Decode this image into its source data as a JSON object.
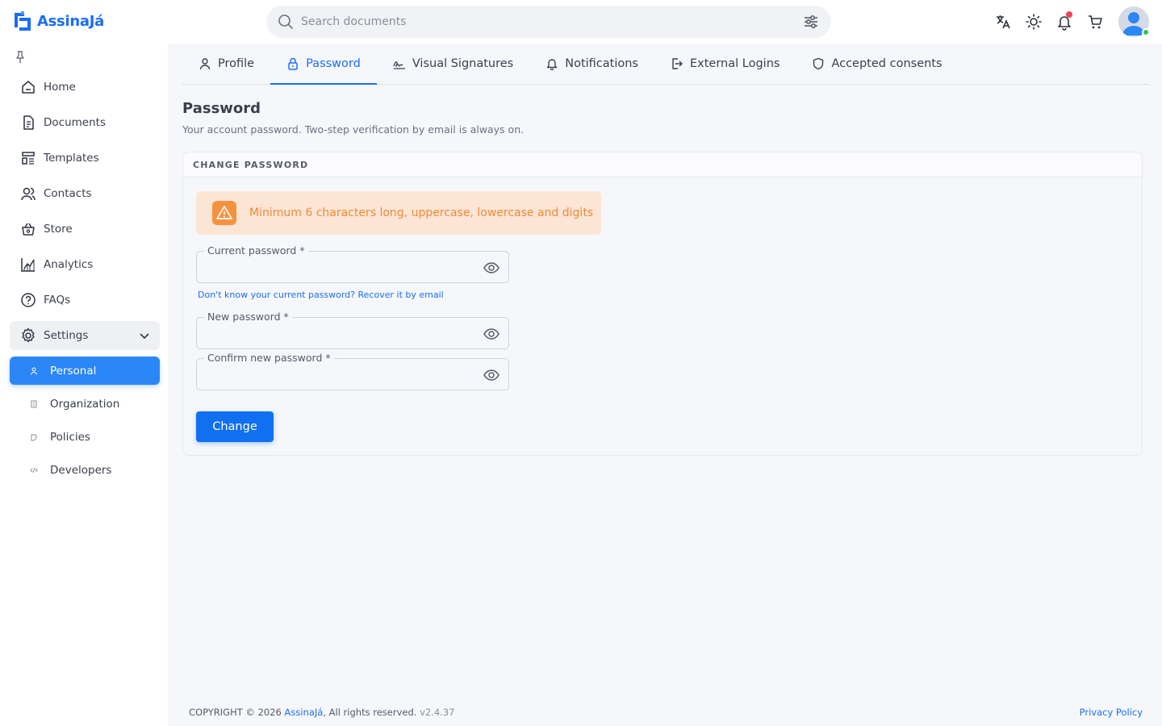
{
  "app": {
    "name": "AssinaJá"
  },
  "header": {
    "search_placeholder": "Search documents"
  },
  "sidebar": {
    "items": [
      {
        "label": "Home",
        "icon": "home-icon"
      },
      {
        "label": "Documents",
        "icon": "document-icon"
      },
      {
        "label": "Templates",
        "icon": "template-icon"
      },
      {
        "label": "Contacts",
        "icon": "contacts-icon"
      },
      {
        "label": "Store",
        "icon": "store-icon"
      },
      {
        "label": "Analytics",
        "icon": "analytics-icon"
      },
      {
        "label": "FAQs",
        "icon": "help-icon"
      },
      {
        "label": "Settings",
        "icon": "gear-icon"
      }
    ],
    "settings_sub": [
      {
        "label": "Personal",
        "active": true
      },
      {
        "label": "Organization"
      },
      {
        "label": "Policies"
      },
      {
        "label": "Developers"
      }
    ]
  },
  "tabs": [
    {
      "label": "Profile",
      "icon": "user-icon"
    },
    {
      "label": "Password",
      "icon": "lock-icon",
      "active": true
    },
    {
      "label": "Visual Signatures",
      "icon": "signature-icon"
    },
    {
      "label": "Notifications",
      "icon": "bell-icon"
    },
    {
      "label": "External Logins",
      "icon": "login-icon"
    },
    {
      "label": "Accepted consents",
      "icon": "shield-icon"
    }
  ],
  "page": {
    "title": "Password",
    "subtitle": "Your account password. Two-step verification by email is always on."
  },
  "card": {
    "header": "CHANGE PASSWORD",
    "alert": "Minimum 6 characters long, uppercase, lowercase and digits",
    "fields": {
      "current": "Current password *",
      "new": "New password *",
      "confirm": "Confirm new password *"
    },
    "recover_link": "Don't know your current password? Recover it by email",
    "button": "Change"
  },
  "footer": {
    "copyright_prefix": "COPYRIGHT © 2026",
    "brand": "AssinaJá",
    "rights": ", All rights reserved.",
    "version": "v2.4.37",
    "privacy": "Privacy Policy"
  },
  "colors": {
    "accent": "#1a6ef5",
    "active_nav": "#2b86f6",
    "alert_bg": "#fde5d6",
    "alert_text": "#f08a33",
    "notif_dot": "#f04455",
    "online": "#22c55e"
  }
}
